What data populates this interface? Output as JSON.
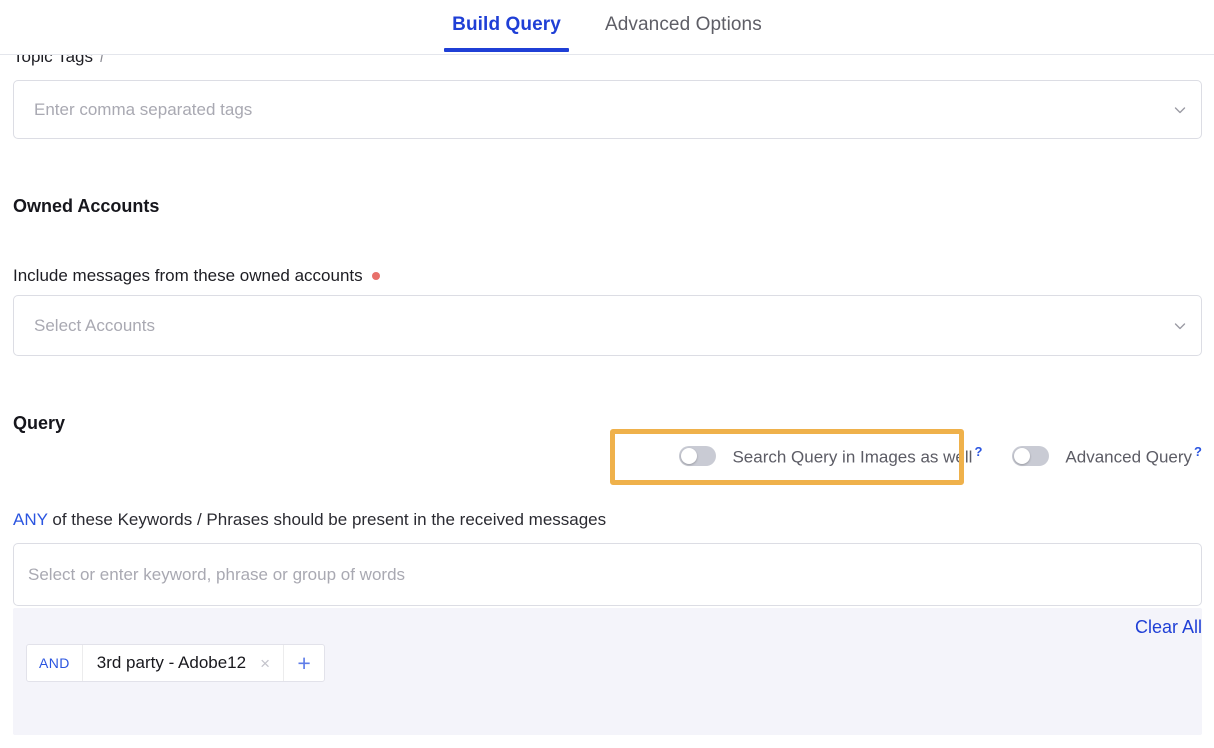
{
  "tabs": [
    {
      "label": "Build Query",
      "active": true
    },
    {
      "label": "Advanced Options",
      "active": false
    }
  ],
  "topic_tags": {
    "label": "Topic Tags",
    "info_icon": "italic-i-info-icon",
    "placeholder": "Enter comma separated tags",
    "chevron": "chevron-down-icon"
  },
  "owned_accounts": {
    "heading": "Owned Accounts",
    "field_label": "Include messages from these owned accounts",
    "required_marker": "•",
    "placeholder": "Select Accounts",
    "chevron": "chevron-down-icon"
  },
  "query": {
    "heading": "Query",
    "toggles": [
      {
        "label": "Search Query in Images as well",
        "help": "?",
        "state": "off",
        "highlighted": true
      },
      {
        "label": "Advanced Query",
        "help": "?",
        "state": "off",
        "highlighted": false
      }
    ],
    "any_line": {
      "operator": "ANY",
      "rest": " of these Keywords / Phrases should be present in the received messages"
    },
    "keyword_placeholder": "Select or enter keyword, phrase or group of words",
    "clear_all": "Clear All",
    "chips": [
      {
        "operator": "AND",
        "value": "3rd party - Adobe12",
        "remove": "×",
        "add": "+"
      }
    ]
  },
  "colors": {
    "accent_blue": "#1f3fd6",
    "link_blue": "#2b55e0",
    "highlight_orange": "#efb14b",
    "required_red": "#e8706a",
    "panel_lavender": "#f4f4fa",
    "placeholder_gray": "#a9a9b2"
  }
}
